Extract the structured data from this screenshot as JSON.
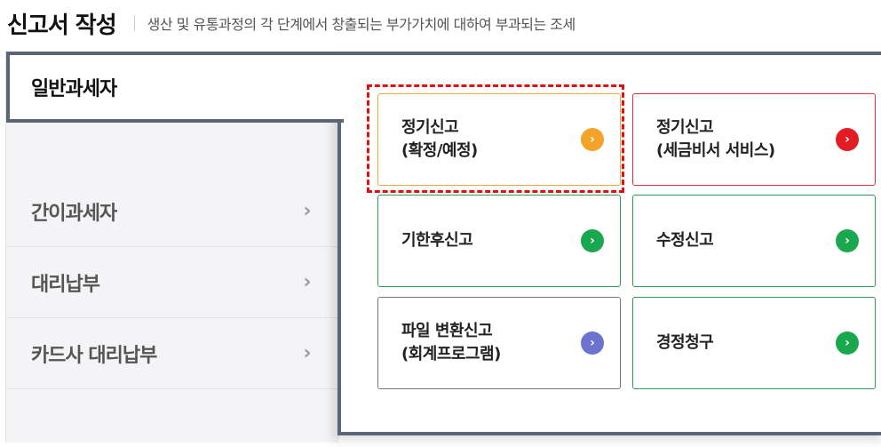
{
  "header": {
    "title": "신고서 작성",
    "subtitle": "생산 및 유통과정의 각 단계에서 창출되는 부가가치에 대하여 부과되는 조세"
  },
  "nav": {
    "active": "일반과세자",
    "items": [
      {
        "label": "간이과세자",
        "chevron": "›"
      },
      {
        "label": "대리납부",
        "chevron": "›"
      },
      {
        "label": "카드사 대리납부",
        "chevron": "›"
      }
    ]
  },
  "cards": [
    {
      "label": "정기신고\n(확정/예정)",
      "border_color": "#e8a93c",
      "arrow_color": "#f3a328",
      "icon": "chevron-right-icon"
    },
    {
      "label": "정기신고\n(세금비서 서비스)",
      "border_color": "#d9323a",
      "arrow_color": "#e31b23",
      "icon": "chevron-right-icon"
    },
    {
      "label": "기한후신고",
      "border_color": "#2e9e5b",
      "arrow_color": "#1aa84e",
      "icon": "chevron-right-icon"
    },
    {
      "label": "수정신고",
      "border_color": "#2e9e5b",
      "arrow_color": "#1aa84e",
      "icon": "chevron-right-icon"
    },
    {
      "label": "파일 변환신고\n(회계프로그램)",
      "border_color": "#777777",
      "arrow_color": "#6b72d0",
      "icon": "chevron-right-icon"
    },
    {
      "label": "경정청구",
      "border_color": "#2e9e5b",
      "arrow_color": "#1aa84e",
      "icon": "chevron-right-icon"
    }
  ],
  "arrow_glyph": "›"
}
